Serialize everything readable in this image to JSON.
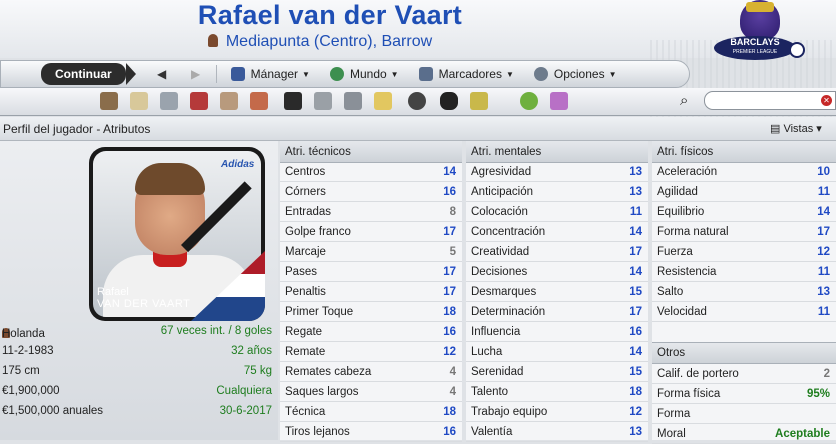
{
  "header": {
    "player_name": "Rafael van der Vaart",
    "subtitle": "Mediapunta (Centro), Barrow",
    "logo_text_1": "BARCLAYS",
    "logo_text_2": "PREMIER LEAGUE"
  },
  "nav": {
    "continue_label": "Continuar",
    "menus": [
      "Mánager",
      "Mundo",
      "Marcadores",
      "Opciones"
    ]
  },
  "section": {
    "title": "Perfil del jugador - Atributos",
    "views_label": "Vistas"
  },
  "card": {
    "first_name": "Rafael",
    "last_name": "VAN DER VAART",
    "brand": "Adidas"
  },
  "info": [
    {
      "left": "Holanda",
      "right": "67 veces int. / 8 goles"
    },
    {
      "left": "11-2-1983",
      "right": "32 años"
    },
    {
      "left": "175 cm",
      "right": "75 kg"
    },
    {
      "left": "€1,900,000",
      "right": "Cualquiera"
    },
    {
      "left": "€1,500,000 anuales",
      "right": "30-6-2017"
    }
  ],
  "technical": {
    "title": "Atri. técnicos",
    "rows": [
      {
        "name": "Centros",
        "value": "14"
      },
      {
        "name": "Córners",
        "value": "16"
      },
      {
        "name": "Entradas",
        "value": "8"
      },
      {
        "name": "Golpe franco",
        "value": "17"
      },
      {
        "name": "Marcaje",
        "value": "5"
      },
      {
        "name": "Pases",
        "value": "17"
      },
      {
        "name": "Penaltis",
        "value": "17"
      },
      {
        "name": "Primer Toque",
        "value": "18"
      },
      {
        "name": "Regate",
        "value": "16"
      },
      {
        "name": "Remate",
        "value": "12"
      },
      {
        "name": "Remates cabeza",
        "value": "4"
      },
      {
        "name": "Saques largos",
        "value": "4"
      },
      {
        "name": "Técnica",
        "value": "18"
      },
      {
        "name": "Tiros lejanos",
        "value": "16"
      }
    ]
  },
  "mental": {
    "title": "Atri. mentales",
    "rows": [
      {
        "name": "Agresividad",
        "value": "13"
      },
      {
        "name": "Anticipación",
        "value": "13"
      },
      {
        "name": "Colocación",
        "value": "11"
      },
      {
        "name": "Concentración",
        "value": "14"
      },
      {
        "name": "Creatividad",
        "value": "17"
      },
      {
        "name": "Decisiones",
        "value": "14"
      },
      {
        "name": "Desmarques",
        "value": "15"
      },
      {
        "name": "Determinación",
        "value": "17"
      },
      {
        "name": "Influencia",
        "value": "16"
      },
      {
        "name": "Lucha",
        "value": "14"
      },
      {
        "name": "Serenidad",
        "value": "15"
      },
      {
        "name": "Talento",
        "value": "18"
      },
      {
        "name": "Trabajo equipo",
        "value": "12"
      },
      {
        "name": "Valentía",
        "value": "13"
      }
    ]
  },
  "physical": {
    "title": "Atri. físicos",
    "rows": [
      {
        "name": "Aceleración",
        "value": "10"
      },
      {
        "name": "Agilidad",
        "value": "11"
      },
      {
        "name": "Equilibrio",
        "value": "14"
      },
      {
        "name": "Forma natural",
        "value": "17"
      },
      {
        "name": "Fuerza",
        "value": "12"
      },
      {
        "name": "Resistencia",
        "value": "11"
      },
      {
        "name": "Salto",
        "value": "13"
      },
      {
        "name": "Velocidad",
        "value": "11"
      }
    ]
  },
  "others": {
    "title": "Otros",
    "rows": [
      {
        "name": "Calif. de portero",
        "value": "2"
      },
      {
        "name": "Forma física",
        "value": "95%"
      },
      {
        "name": "Forma",
        "value": ""
      },
      {
        "name": "Moral",
        "value": "Aceptable"
      }
    ]
  }
}
